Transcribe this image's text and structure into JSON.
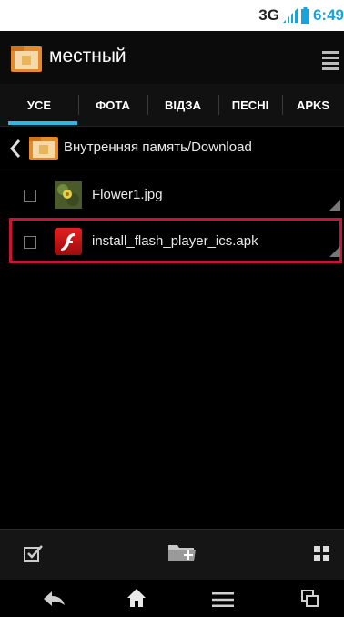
{
  "status_bar": {
    "network": "3G",
    "time": "6:49"
  },
  "action_bar": {
    "title": "местный"
  },
  "tabs": [
    {
      "label": "УСЕ",
      "active": true
    },
    {
      "label": "ФОТА",
      "active": false
    },
    {
      "label": "ВІДЗА",
      "active": false
    },
    {
      "label": "ПЕСНІ",
      "active": false
    },
    {
      "label": "APKS",
      "active": false
    }
  ],
  "breadcrumb": {
    "path": "Внутренняя память/Download"
  },
  "files": [
    {
      "name": "Flower1.jpg",
      "icon": "image-thumbnail-icon",
      "highlighted": false
    },
    {
      "name": "install_flash_player_ics.apk",
      "icon": "flash-player-icon",
      "highlighted": true
    }
  ],
  "colors": {
    "accent": "#33b5e5",
    "highlight": "#c8143a",
    "status_time": "#1aa3d9"
  }
}
